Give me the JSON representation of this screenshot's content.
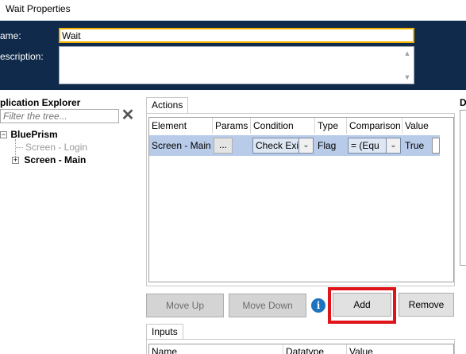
{
  "window": {
    "title": "Wait Properties"
  },
  "header": {
    "name_label": "ame:",
    "name_value": "Wait",
    "description_label": "escription:",
    "description_value": ""
  },
  "app_explorer": {
    "title": "plication Explorer",
    "filter_placeholder": "Filter the tree...",
    "tree": {
      "root": "BluePrism",
      "children": [
        {
          "label": "Screen - Login",
          "greyed": true
        },
        {
          "label": "Screen - Main",
          "bold": true,
          "expandable": true
        }
      ]
    }
  },
  "actions": {
    "tab_label": "Actions",
    "columns": [
      "Element",
      "Params",
      "Condition",
      "Type",
      "Comparison",
      "Value"
    ],
    "rows": [
      {
        "element": "Screen - Main",
        "params_button": "...",
        "condition": "Check Exi",
        "type": "Flag",
        "comparison": "= (Equ",
        "value": "True"
      }
    ],
    "buttons": {
      "move_up": "Move Up",
      "move_down": "Move Down",
      "add": "Add",
      "remove": "Remove"
    }
  },
  "inputs": {
    "tab_label": "Inputs",
    "columns": [
      "Name",
      "Datatype",
      "Value"
    ]
  },
  "right_panel": {
    "label": "D"
  },
  "colors": {
    "header_bg": "#0f2a4a",
    "name_border": "#f0b400",
    "selected_row": "#b8cbe8",
    "highlight": "#e0151b",
    "info_blue": "#1e73be"
  }
}
